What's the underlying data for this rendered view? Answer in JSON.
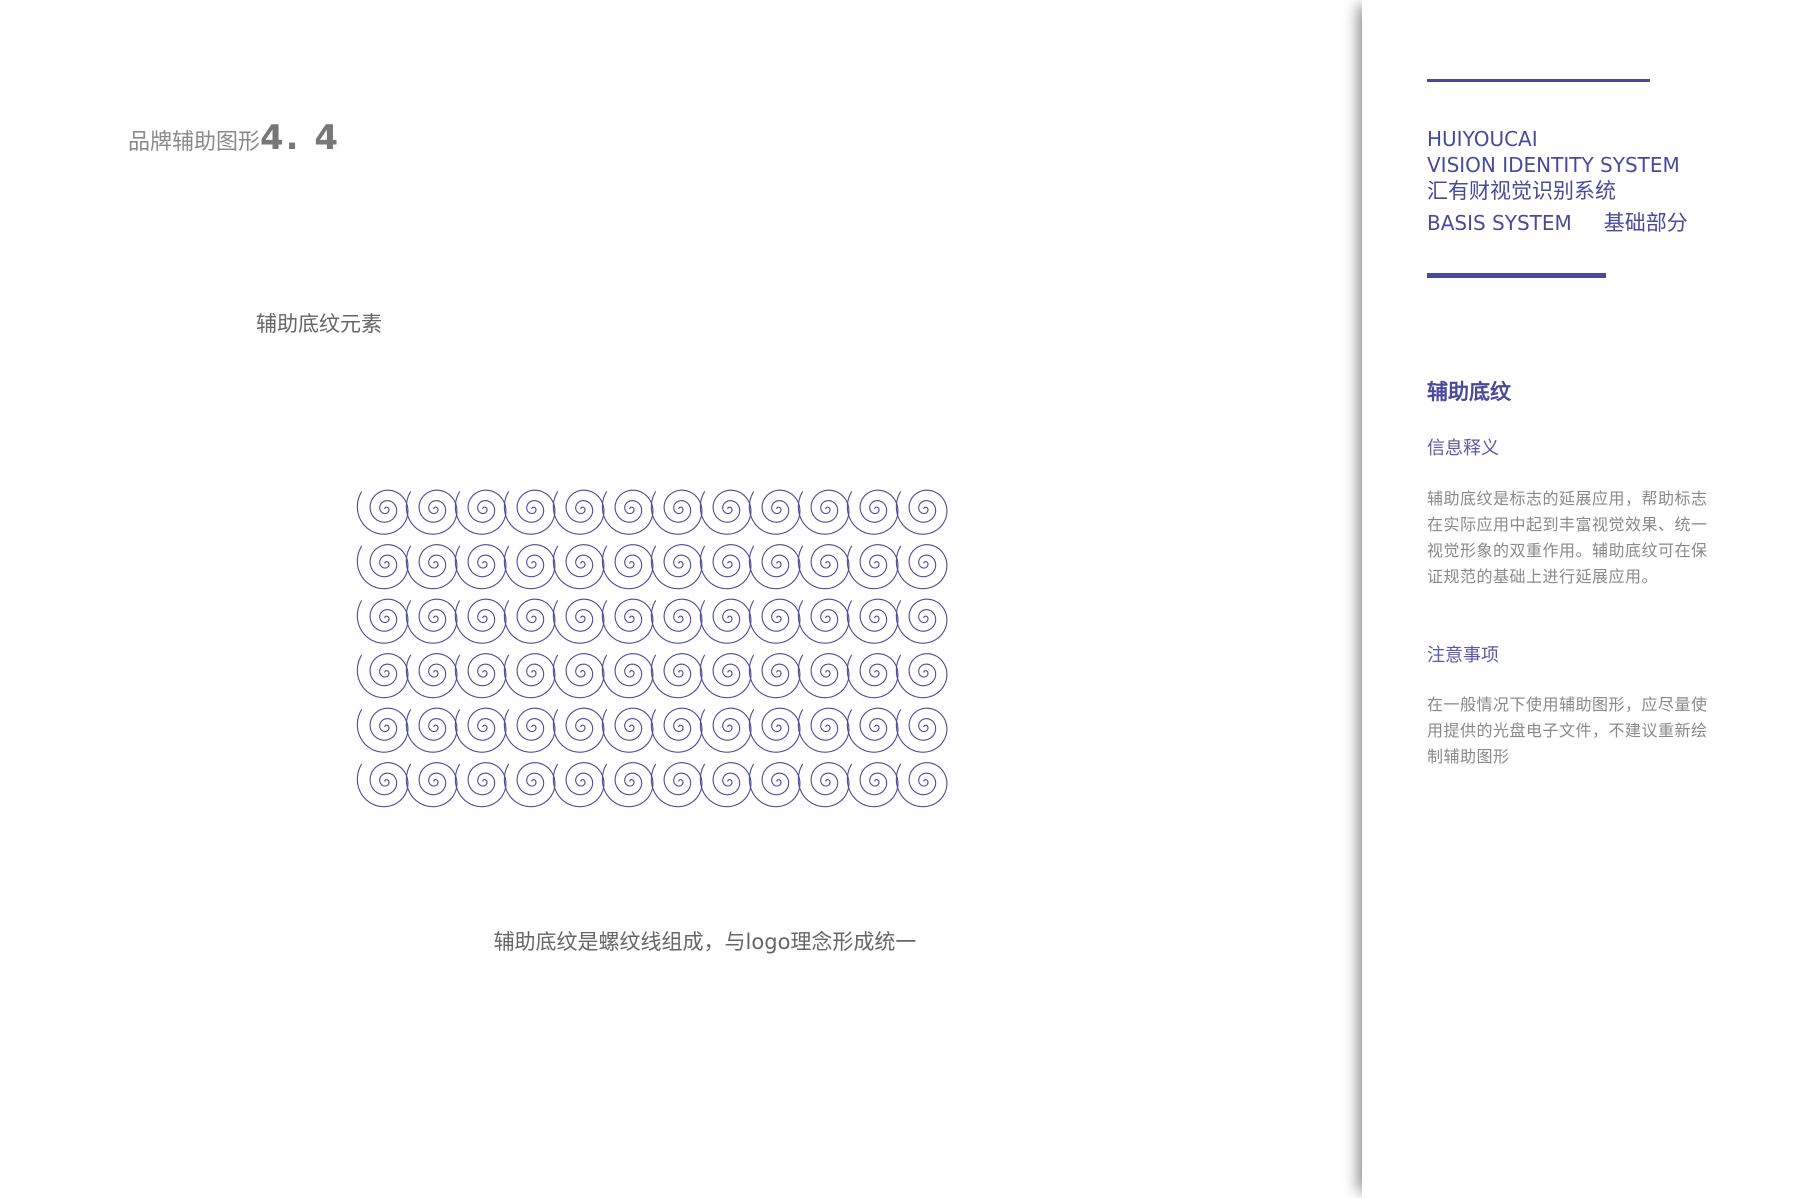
{
  "main": {
    "title_text": "品牌辅助图形",
    "title_number": "4. 4",
    "subtitle": "辅助底纹元素",
    "caption": "辅助底纹是螺纹线组成，与logo理念形成统一"
  },
  "pattern": {
    "rows": 6,
    "cols": 12,
    "color": "#4a4a9c"
  },
  "sidebar": {
    "brand_en": "HUIYOUCAI",
    "system_en": "VISION IDENTITY SYSTEM",
    "system_cn": "汇有财视觉识别系统",
    "basis_en": "BASIS SYSTEM",
    "basis_cn": "基础部分",
    "heading": "辅助底纹",
    "info_label": "信息释义",
    "info_text": "辅助底纹是标志的延展应用，帮助标志在实际应用中起到丰富视觉效果、统一视觉形象的双重作用。辅助底纹可在保证规范的基础上进行延展应用。",
    "note_label": "注意事项",
    "note_text": "在一般情况下使用辅助图形，应尽量使用提供的光盘电子文件，不建议重新绘制辅助图形"
  },
  "colors": {
    "accent": "#4a4a9c",
    "text_gray": "#666666",
    "body_gray": "#8a8a8a"
  }
}
